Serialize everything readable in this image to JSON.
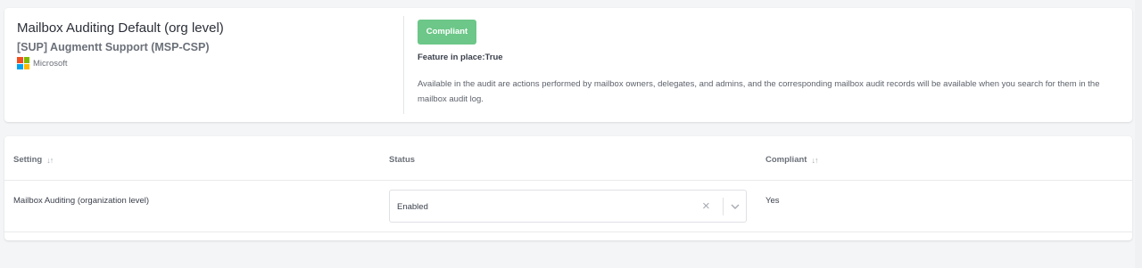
{
  "policy": {
    "title": "Mailbox Auditing Default (org level)",
    "tenant": "[SUP] Augmentt Support (MSP-CSP)",
    "vendor": "Microsoft",
    "status_badge": "Compliant",
    "feature_in_place": "Feature in place:True",
    "description": "Available in the audit are actions performed by mailbox owners, delegates, and admins, and the corresponding mailbox audit records will be available when you search for them in the mailbox audit log."
  },
  "colors": {
    "badge_green": "#6cc788",
    "ms_red": "#f25022",
    "ms_green": "#7fba00",
    "ms_blue": "#00a4ef",
    "ms_yellow": "#ffb900"
  },
  "table": {
    "columns": [
      {
        "label": "Setting",
        "sortable": true
      },
      {
        "label": "Status",
        "sortable": false
      },
      {
        "label": "Compliant",
        "sortable": true
      }
    ],
    "rows": [
      {
        "setting": "Mailbox Auditing (organization level)",
        "status": "Enabled",
        "compliant": "Yes"
      }
    ]
  },
  "icons": {
    "sort": "sort-arrows-icon",
    "clear": "clear-x-icon",
    "dropdown": "chevron-down-icon",
    "vendor_logo": "microsoft-logo-icon"
  }
}
